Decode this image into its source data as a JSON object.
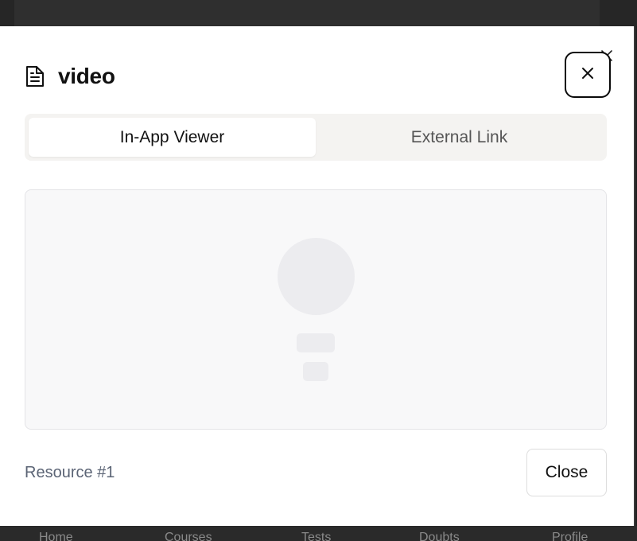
{
  "modal": {
    "title": "video",
    "title_icon": "document-icon",
    "close_icon": "close-icon",
    "tabs": [
      {
        "label": "In-App Viewer",
        "active": true
      },
      {
        "label": "External Link",
        "active": false
      }
    ],
    "viewer_state": "loading-skeleton",
    "footer": {
      "resource_label": "Resource #1",
      "close_label": "Close"
    }
  },
  "background_nav": {
    "items": [
      "Home",
      "Courses",
      "Tests",
      "Doubts",
      "Profile"
    ]
  },
  "colors": {
    "modal_bg": "#ffffff",
    "tab_track": "#f4f3f1",
    "skeleton": "#ececef",
    "muted_text": "#5b6475"
  }
}
